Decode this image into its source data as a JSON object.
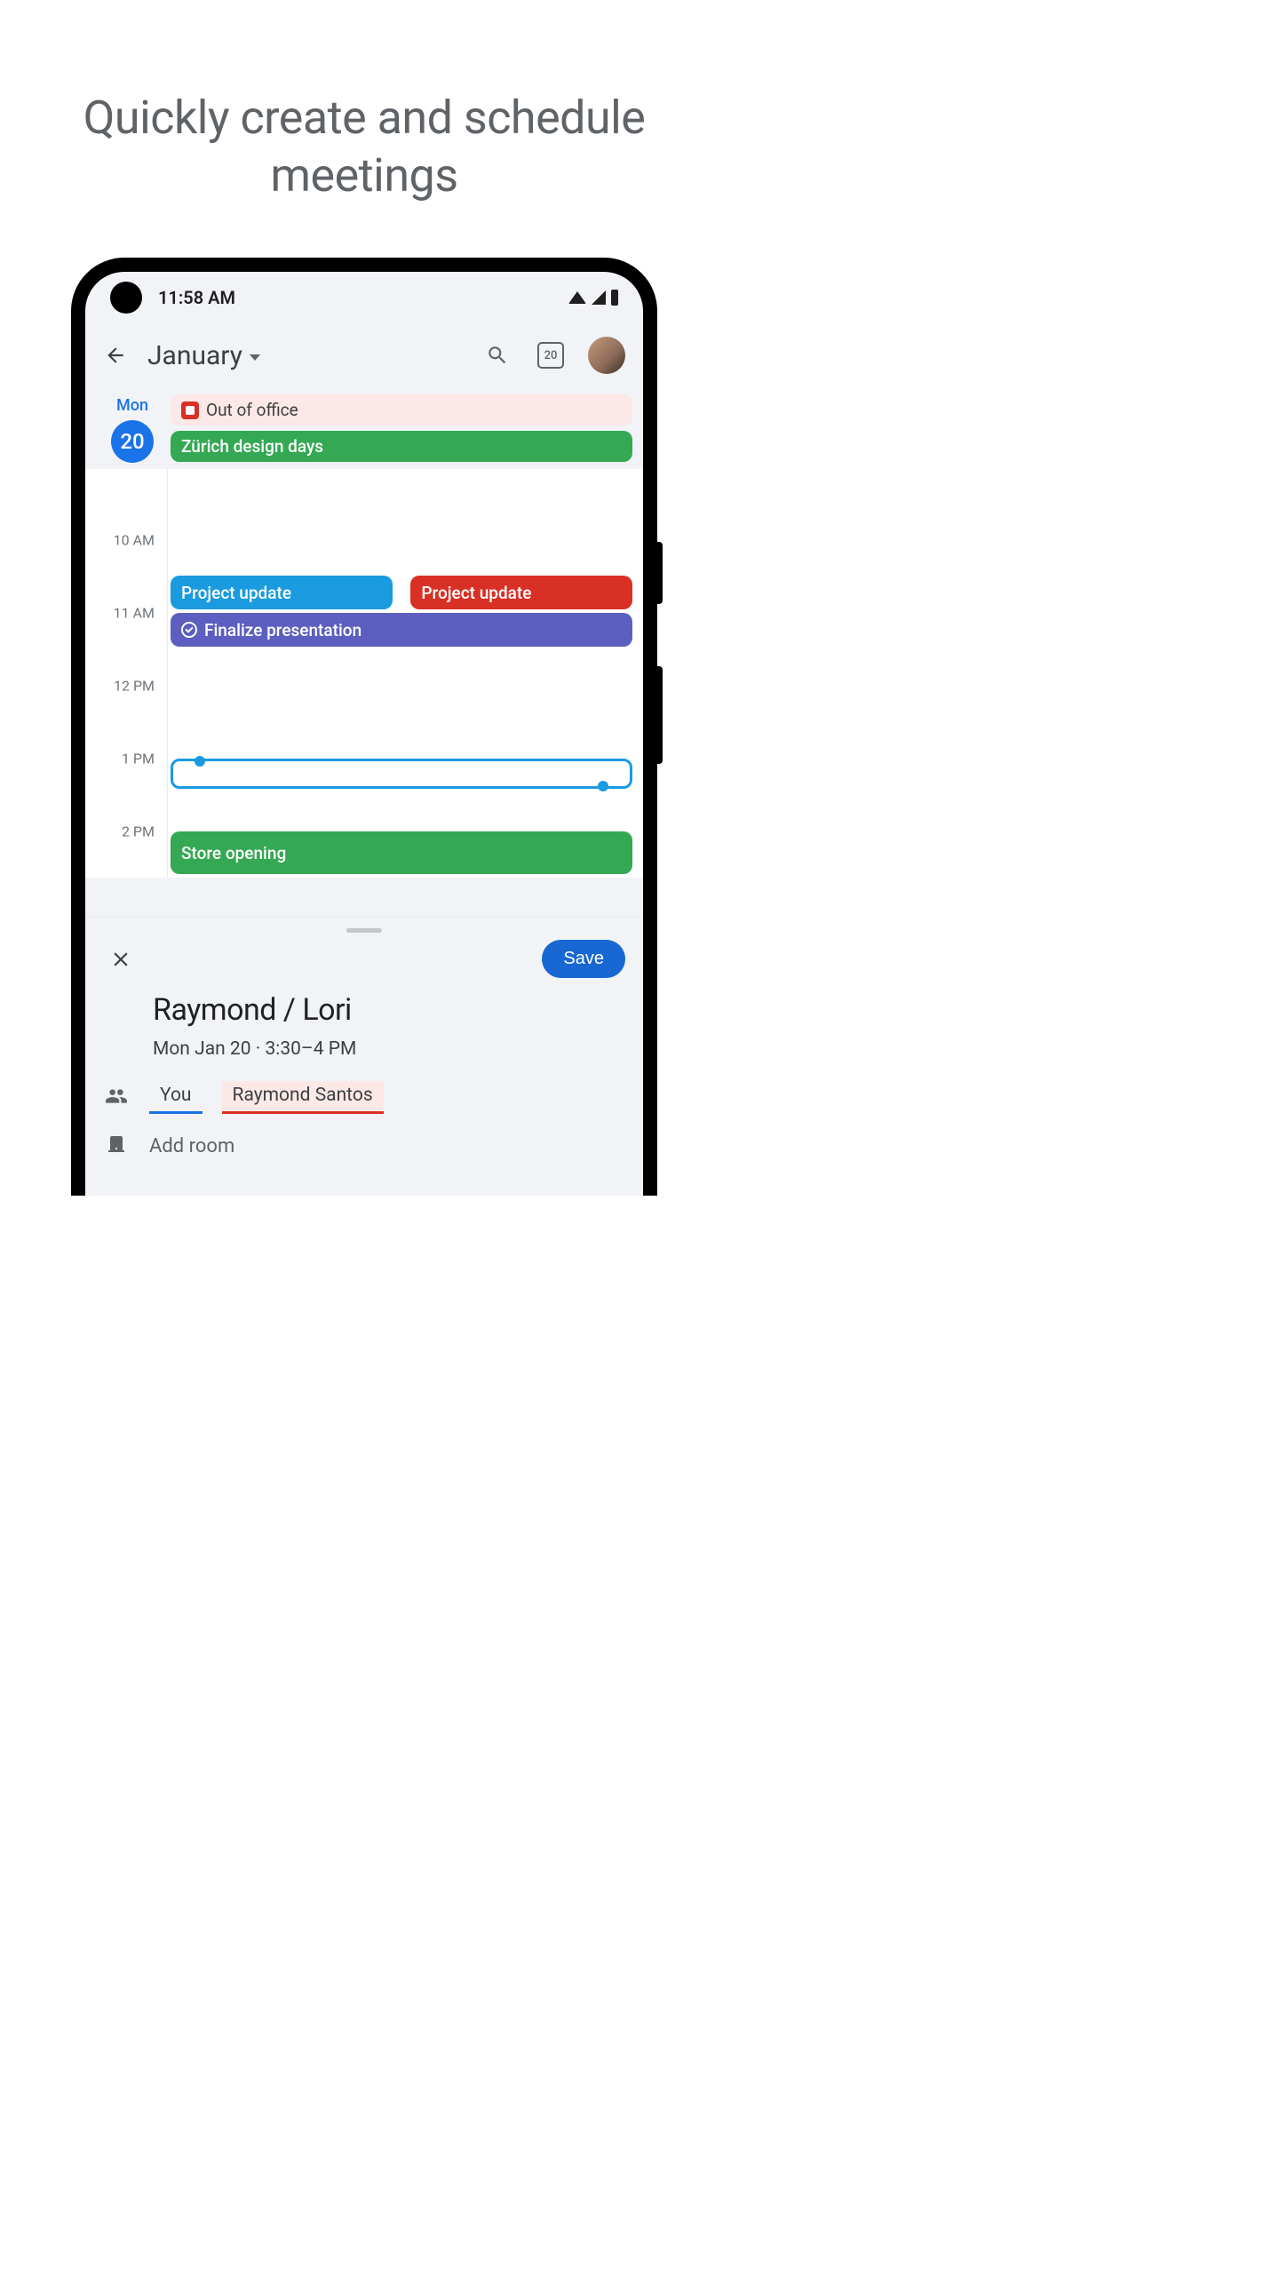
{
  "promo": {
    "headline": "Quickly create and schedule meetings"
  },
  "status": {
    "time": "11:58 AM"
  },
  "header": {
    "month": "January",
    "today_badge": "20"
  },
  "day": {
    "weekday": "Mon",
    "number": "20",
    "allday": [
      {
        "label": "Out of office",
        "kind": "ooo"
      },
      {
        "label": "Zürich design days",
        "kind": "green"
      }
    ]
  },
  "timeline": {
    "labels": [
      "10 AM",
      "11 AM",
      "12 PM",
      "1 PM",
      "2 PM"
    ],
    "events": {
      "proj_blue": "Project update",
      "proj_red": "Project update",
      "finalize": "Finalize presentation",
      "store": "Store opening"
    }
  },
  "sheet": {
    "save": "Save",
    "title": "Raymond / Lori",
    "subtitle": "Mon Jan 20  ·  3:30–4 PM",
    "attendees": {
      "you": "You",
      "raymond": "Raymond Santos"
    },
    "add_room": "Add room"
  }
}
